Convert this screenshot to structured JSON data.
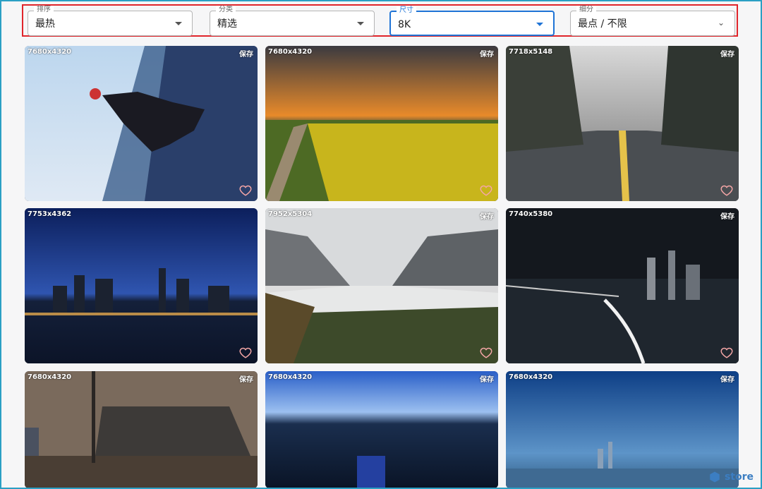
{
  "filters": [
    {
      "label": "排序",
      "value": "最热",
      "active": false
    },
    {
      "label": "分类",
      "value": "精选",
      "active": false
    },
    {
      "label": "尺寸",
      "value": "8K",
      "active": true
    },
    {
      "label": "细分",
      "value": "最点 / 不限",
      "active": false
    }
  ],
  "cards": [
    {
      "resolution": "7680x4320",
      "save": "保存"
    },
    {
      "resolution": "7680x4320",
      "save": "保存"
    },
    {
      "resolution": "7718x5148",
      "save": "保存"
    },
    {
      "resolution": "7753x4362",
      "save": "保存"
    },
    {
      "resolution": "7952x5304",
      "save": "保存"
    },
    {
      "resolution": "7740x5380",
      "save": "保存"
    },
    {
      "resolution": "7680x4320",
      "save": "保存"
    },
    {
      "resolution": "7680x4320",
      "save": "保存"
    },
    {
      "resolution": "7680x4320",
      "save": "保存"
    }
  ],
  "watermark": "store",
  "colors": {
    "accent": "#1f74d6",
    "highlight": "#e0252b",
    "heart": "#f4a6a6"
  }
}
